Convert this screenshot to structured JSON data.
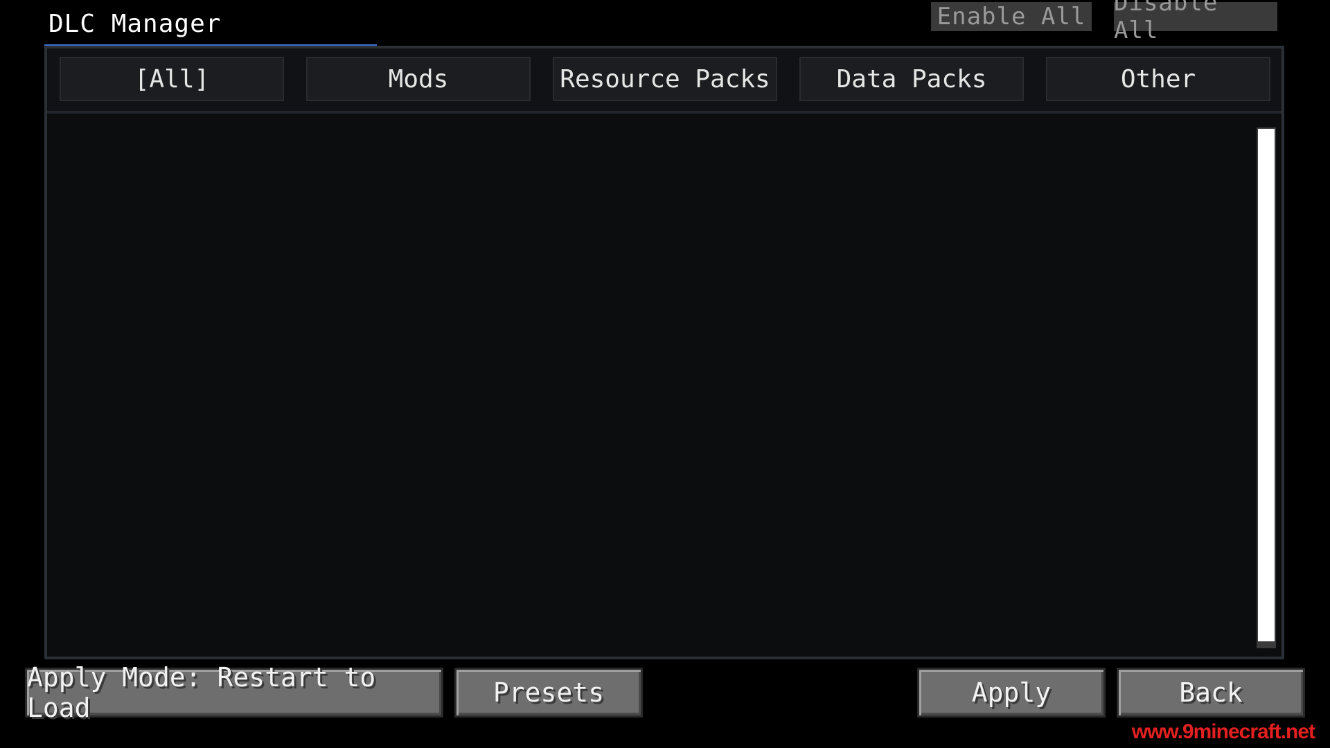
{
  "header": {
    "title": "DLC Manager",
    "enable_all_label": "Enable All",
    "disable_all_label": "Disable All"
  },
  "tabs": [
    {
      "label": "[All]"
    },
    {
      "label": "Mods"
    },
    {
      "label": "Resource Packs"
    },
    {
      "label": "Data Packs"
    },
    {
      "label": "Other"
    }
  ],
  "footer": {
    "apply_mode_label": "Apply Mode: Restart to Load",
    "presets_label": "Presets",
    "apply_label": "Apply",
    "back_label": "Back"
  },
  "watermark": "www.9minecraft.net",
  "colors": {
    "accent": "#3f6fd8",
    "background": "#000000",
    "panel": "#0a0b0d",
    "button": "#6e6e6e"
  }
}
